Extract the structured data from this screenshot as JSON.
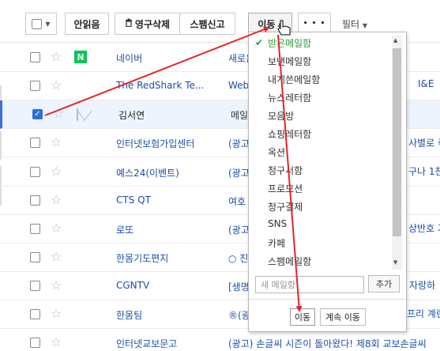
{
  "toolbar": {
    "mark_read": "안읽음",
    "delete": "영구삭제",
    "spam": "스팸신고",
    "move": "이동",
    "more": "• • •",
    "filter": "필터"
  },
  "icons": {
    "trash": "trash-icon",
    "envelope": "envelope-icon",
    "star": "star-icon",
    "caret": "caret-down-icon",
    "check": "check-icon",
    "naver_logo": "naver-logo-icon"
  },
  "mails": [
    {
      "sender": "네이버",
      "subject": "새로운",
      "icon": "naver",
      "selected": false
    },
    {
      "sender": "The RedShark Te...",
      "subject": "Webe",
      "icon": "unread",
      "selected": false
    },
    {
      "sender": "김서연",
      "subject": "메일",
      "icon": "read",
      "selected": true
    },
    {
      "sender": "인터넷보험가입센터",
      "subject": "(광고)",
      "icon": "unread",
      "selected": false
    },
    {
      "sender": "예스24(이벤트)",
      "subject": "(광고)",
      "icon": "unread",
      "selected": false
    },
    {
      "sender": "CTS QT",
      "subject": "여호",
      "icon": "unread",
      "selected": false
    },
    {
      "sender": "로또",
      "subject": "(광고)",
      "icon": "unread",
      "selected": false
    },
    {
      "sender": "한몸기도편지",
      "subject": "○ 진",
      "icon": "unread",
      "selected": false
    },
    {
      "sender": "CGNTV",
      "subject": "[생명",
      "icon": "unread",
      "selected": false
    },
    {
      "sender": "한몸팀",
      "subject": "®(광",
      "icon": "unread",
      "selected": false
    },
    {
      "sender": "인터넷교보문고",
      "subject": "(광고) 손글씨 시즌이 돌아왔다! 제8회 교보손글씨",
      "icon": "unread",
      "selected": false
    }
  ],
  "right_edge": [
    {
      "text": "I&E"
    },
    {
      "text": "사별로 즉"
    },
    {
      "text": "구나 1천"
    },
    {
      "text": "상반호 기"
    },
    {
      "text": "자랑하"
    },
    {
      "text": "프리 계린"
    }
  ],
  "folder_menu": {
    "folders": [
      {
        "label": "받은메일함",
        "active": true
      },
      {
        "label": "보낸메일함",
        "active": false
      },
      {
        "label": "내게쓴메일함",
        "active": false
      },
      {
        "label": "뉴스레터함",
        "active": false
      },
      {
        "label": "모음방",
        "active": false
      },
      {
        "label": "쇼핑레터함",
        "active": false
      },
      {
        "label": "옥션",
        "active": false
      },
      {
        "label": "청구서함",
        "active": false
      },
      {
        "label": "프로모션",
        "active": false
      },
      {
        "label": "청구결제",
        "active": false
      },
      {
        "label": "SNS",
        "active": false
      },
      {
        "label": "카페",
        "active": false
      },
      {
        "label": "스팸메일함",
        "active": false
      }
    ],
    "new_folder_placeholder": "새 메일함",
    "add_label": "추가",
    "move_label": "이동",
    "keep_move_label": "계속 이동"
  },
  "colors": {
    "accent": "#2f6fe0",
    "sender_link": "#1a4fa8",
    "active_folder": "#2a9a3a",
    "annotation_arrow": "#e0262b",
    "naver_green": "#03c75a"
  }
}
